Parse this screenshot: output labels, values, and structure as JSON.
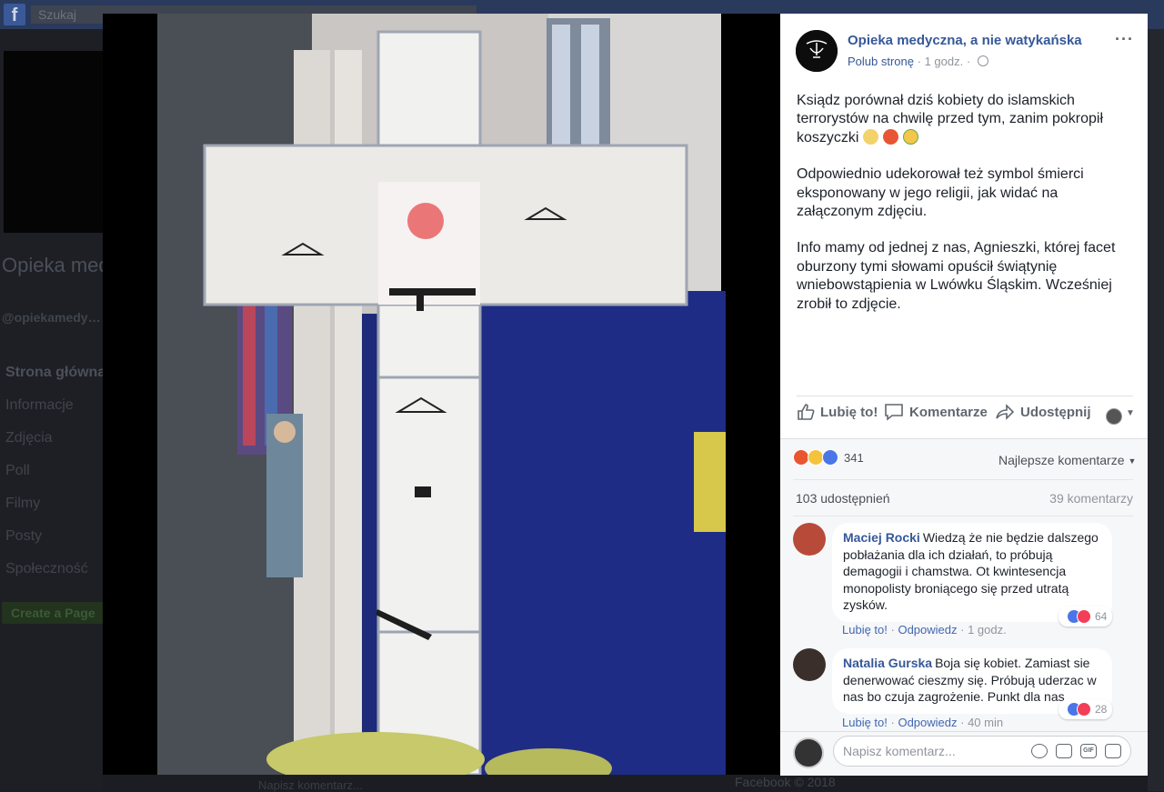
{
  "background": {
    "search_placeholder": "Szukaj",
    "page_name": "Opieka med… a nie watyk…",
    "handle": "@opiekamedy… kańska",
    "nav": [
      "Strona główna",
      "Informacje",
      "Zdjęcia",
      "Poll",
      "Filmy",
      "Posty",
      "Społeczność"
    ],
    "create_page": "Create a Page",
    "footer": "Facebook © 2018",
    "bottom_input": "Napisz komentarz..."
  },
  "post": {
    "page_name": "Opieka medyczna, a nie watykańska",
    "like_page": "Polub stronę",
    "time": "1 godz.",
    "more": "···",
    "paragraphs": [
      "Ksiądz porównał dziś kobiety do islamskich terrorystów na chwilę przed tym, zanim pokropił koszyczki",
      "Odpowiednio udekorował też symbol śmierci eksponowany w jego religii, jak widać na załączonym zdjęciu.",
      "Info mamy od jednej z nas, Agnieszki, której facet oburzony tymi słowami opuścił świątynię wniebowstąpienia w Lwówku Śląskim. Wcześniej zrobił to zdjęcie."
    ],
    "actions": {
      "like": "Lubię to!",
      "comment": "Komentarze",
      "share": "Udostępnij"
    },
    "reactions_count": "341",
    "sort_label": "Najlepsze komentarze",
    "shares": "103 udostępnień",
    "comments_count": "39 komentarzy"
  },
  "comments": [
    {
      "author": "Maciej Rocki",
      "text": "Wiedzą że nie będzie dalszego pobłażania dla ich działań, to próbują demagogii i chamstwa. Ot kwintesencja monopolisty broniącego się przed utratą zysków.",
      "like": "Lubię to!",
      "reply": "Odpowiedz",
      "time": "1 godz.",
      "reactions": "64"
    },
    {
      "author": "Natalia Gurska",
      "text": "Boja się kobiet. Zamiast sie denerwować cieszmy się. Próbują uderzac w nas bo czuja zagrożenie. Punkt dla nas",
      "like": "Lubię to!",
      "reply": "Odpowiedz",
      "time": "40 min",
      "reactions": "28"
    }
  ],
  "composer": {
    "placeholder": "Napisz komentarz..."
  },
  "colors": {
    "link": "#365899",
    "text": "#1d2129",
    "muted": "#90949c",
    "background_dim": "#1b1d22"
  }
}
